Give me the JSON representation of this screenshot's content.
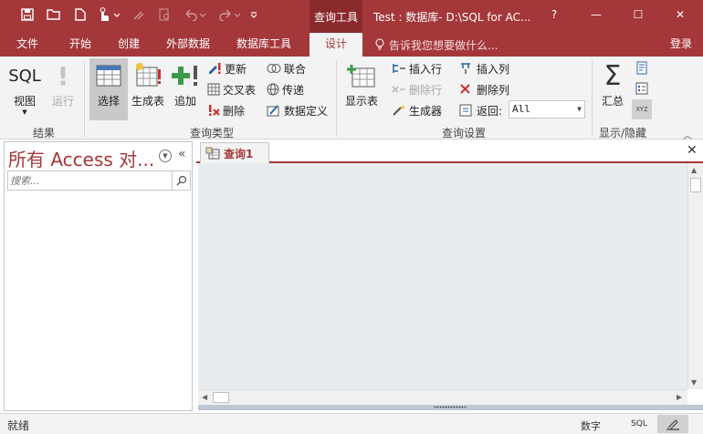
{
  "window": {
    "context_group": "查询工具",
    "title": "Test : 数据库- D:\\SQL for AC...",
    "help": "?",
    "minimize": "—",
    "maximize": "☐",
    "close": "✕"
  },
  "tabs": [
    {
      "label": "文件"
    },
    {
      "label": "开始"
    },
    {
      "label": "创建"
    },
    {
      "label": "外部数据"
    },
    {
      "label": "数据库工具"
    },
    {
      "label": "设计",
      "active": true
    }
  ],
  "tell_me": "告诉我您想要做什么...",
  "login": "登录",
  "ribbon": {
    "groups": {
      "results": "结果",
      "query_type": "查询类型",
      "query_setup": "查询设置",
      "show_hide": "显示/隐藏"
    },
    "view_label": "视图",
    "view_icon_text": "SQL",
    "run_label": "运行",
    "select_label": "选择",
    "make_table_label": "生成表",
    "append_label": "追加",
    "update_label": "更新",
    "crosstab_label": "交叉表",
    "delete_label": "删除",
    "union_label": "联合",
    "passthrough_label": "传递",
    "data_def_label": "数据定义",
    "show_table_label": "显示表",
    "insert_rows_label": "插入行",
    "delete_rows_label": "删除行",
    "builder_label": "生成器",
    "insert_cols_label": "插入列",
    "delete_cols_label": "删除列",
    "return_label": "返回:",
    "return_value": "All",
    "totals_label": "汇总",
    "totals_icon": "Σ",
    "xyz_label": "XYZ"
  },
  "nav": {
    "title": "所有 Access 对...",
    "search_placeholder": "搜索..."
  },
  "document": {
    "tab_label": "查询1"
  },
  "status": {
    "text": "就绪",
    "numlock": "数字",
    "sql_view": "SQL"
  },
  "colors": {
    "accent": "#a4373a",
    "context_bg": "#8b2a2d",
    "ribbon_bg": "#f3f3f3",
    "canvas_bg": "#e8ecef"
  }
}
